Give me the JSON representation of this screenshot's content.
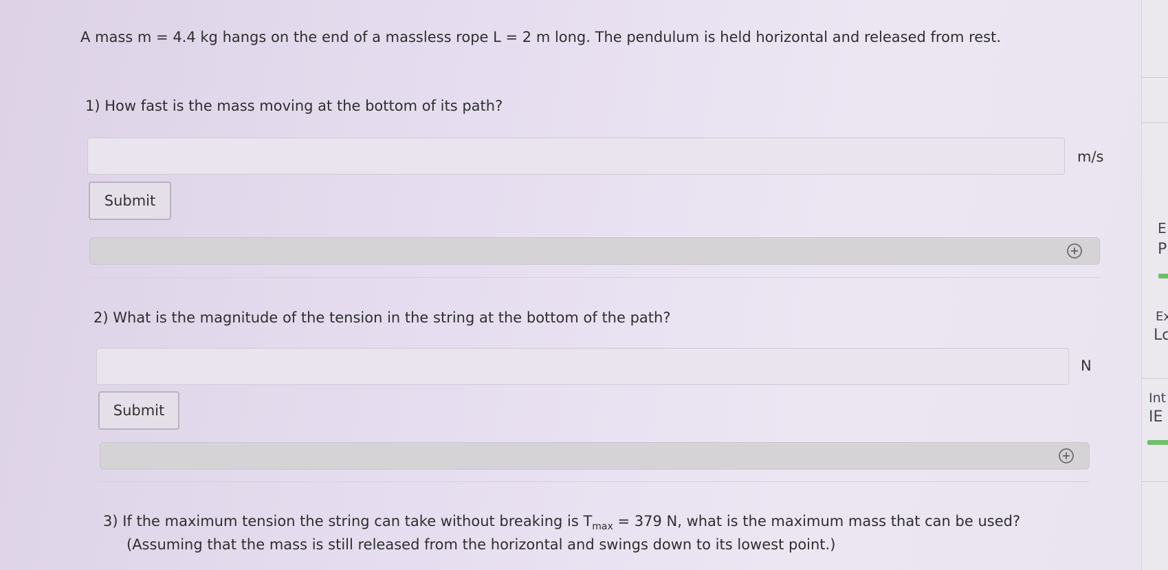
{
  "problem": {
    "intro": "A mass m = 4.4 kg hangs on the end of a massless rope L = 2 m long. The pendulum is held horizontal and released from rest."
  },
  "questions": [
    {
      "prompt": "1) How fast is the mass moving at the bottom of its path?",
      "input_value": "",
      "unit": "m/s",
      "submit_label": "Submit",
      "hint_toggle": "+"
    },
    {
      "prompt": "2) What is the magnitude of the tension in the string at the bottom of the path?",
      "input_value": "",
      "unit": "N",
      "submit_label": "Submit",
      "hint_toggle": "+"
    },
    {
      "prompt_prefix": "3) If the maximum tension the string can take without breaking is T",
      "prompt_sub": "max",
      "prompt_suffix": " = 379 N, what is the maximum mass that can be used?",
      "prompt_line2": "(Assuming that the mass is still released from the horizontal and swings down to its lowest point.)"
    }
  ],
  "sidebar": {
    "fragments": [
      "E",
      "P",
      "Ex",
      "Lc",
      "Int",
      "IE"
    ]
  }
}
